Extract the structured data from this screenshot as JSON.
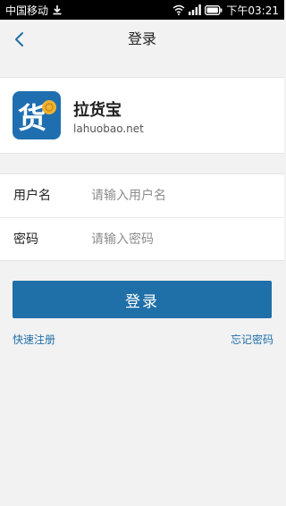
{
  "statusbar": {
    "carrier": "中国移动",
    "time": "下午03:21",
    "icons": [
      "download-icon",
      "wifi-icon",
      "signal-icon",
      "battery-icon"
    ]
  },
  "nav": {
    "back_icon": "chevron-left-icon",
    "title": "登录"
  },
  "brand": {
    "logo_char": "货",
    "name": "拉货宝",
    "domain": "lahuobao.net"
  },
  "form": {
    "username": {
      "label": "用户名",
      "placeholder": "请输入用户名",
      "value": ""
    },
    "password": {
      "label": "密码",
      "placeholder": "请输入密码",
      "value": ""
    }
  },
  "actions": {
    "login_label": "登录",
    "register_link": "快速注册",
    "forgot_link": "忘记密码"
  },
  "colors": {
    "accent": "#1f6fa8",
    "background": "#f2f2f2",
    "logo_bg": "#1f6fb0",
    "logo_coin": "#f2b233"
  }
}
